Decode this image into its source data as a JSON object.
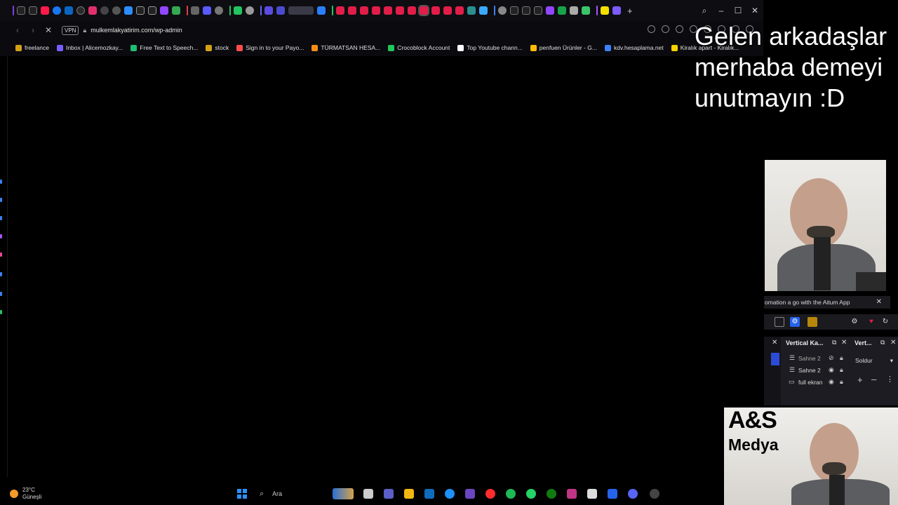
{
  "browser": {
    "url": "mulkemlakyatirim.com/wp-admin",
    "vpn_label": "VPN",
    "bookmarks": [
      {
        "label": "freelance",
        "color": "#d4a017"
      },
      {
        "label": "Inbox | Alicemozkay...",
        "color": "#7b5cff"
      },
      {
        "label": "Free Text to Speech...",
        "color": "#1fbf73"
      },
      {
        "label": "stock",
        "color": "#d4a017"
      },
      {
        "label": "Sign in to your Payo...",
        "color": "#ff4d4d"
      },
      {
        "label": "TÜRMATSAN HESA...",
        "color": "#ff8c1a"
      },
      {
        "label": "Crocoblock Account",
        "color": "#22c55e"
      },
      {
        "label": "Top Youtube chann...",
        "color": "#ffffff"
      },
      {
        "label": "penfuen Ürünler - G...",
        "color": "#fbbc04"
      },
      {
        "label": "kdv.hesaplama.net",
        "color": "#3b82f6"
      },
      {
        "label": "Kiralık apart - Kiralık...",
        "color": "#f7d000"
      }
    ]
  },
  "window_controls": {
    "search": "⌕",
    "minimize": "–",
    "maximize": "☐",
    "close": "✕"
  },
  "caption": {
    "line1": "Gelen arkadaşlar",
    "line2": "merhaba demeyi",
    "line3": "unutmayın :D"
  },
  "obs": {
    "banner_text": "omation a go with the Aitum App",
    "banner_close": "✕",
    "dock1_title": "Vertical Ka...",
    "dock2_title": "Vert...",
    "scenes": [
      "Sahne 2",
      "Sahne 2",
      "full ekran"
    ],
    "transition_label": "Soldur",
    "add": "+",
    "remove": "–",
    "more": "⋮"
  },
  "logo": {
    "brand": "A&S",
    "sub": "Medya"
  },
  "taskbar": {
    "temperature": "23°C",
    "weather": "Güneşli",
    "search_label": "Ara"
  }
}
